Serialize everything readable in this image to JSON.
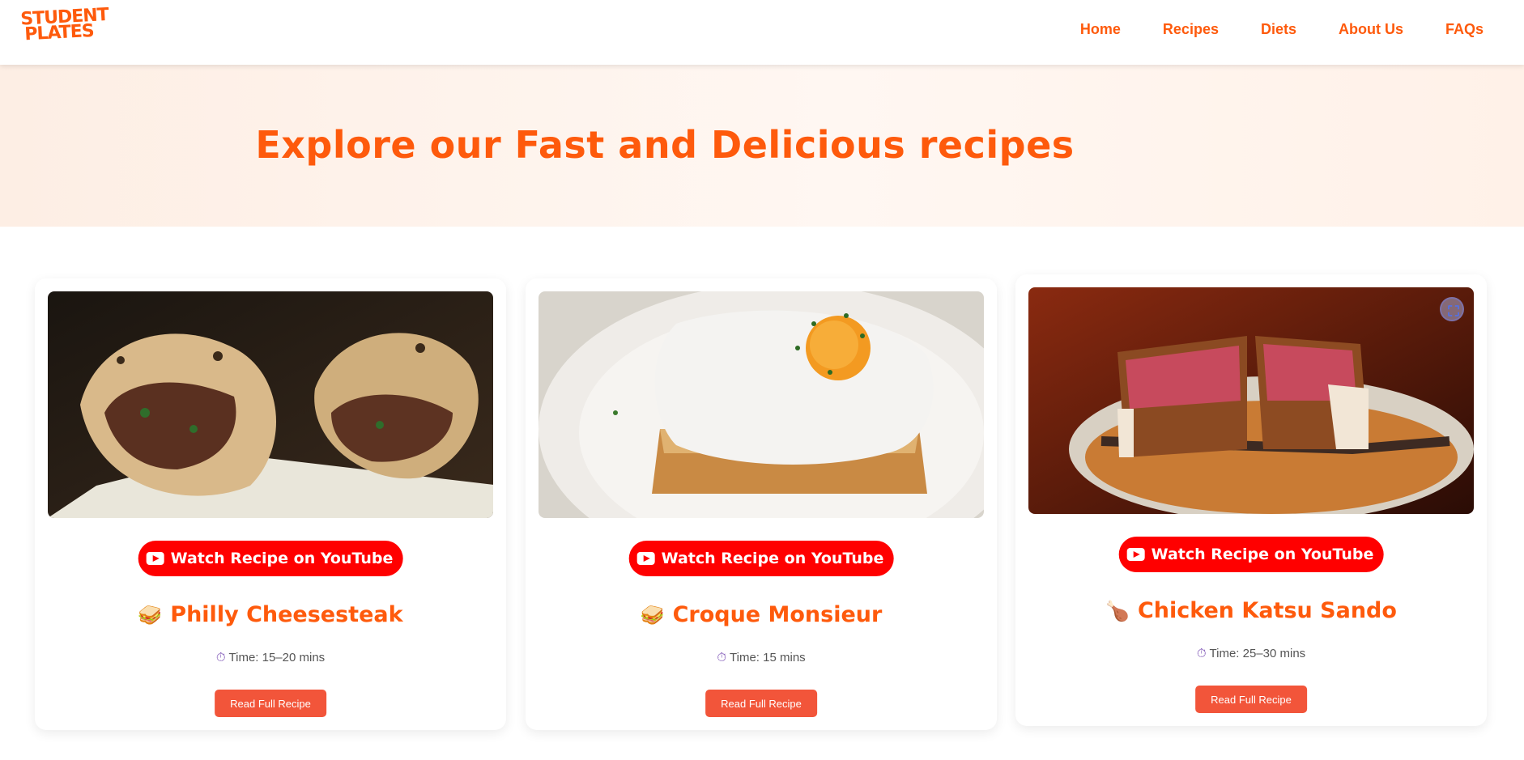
{
  "header": {
    "logo_line1": "STUDENT",
    "logo_line2": "PLATES",
    "nav": [
      "Home",
      "Recipes",
      "Diets",
      "About Us",
      "FAQs"
    ]
  },
  "hero": {
    "title": "Explore our Fast and Delicious recipes"
  },
  "recipes": [
    {
      "youtube_label": "Watch Recipe on YouTube",
      "emoji": "🥪",
      "name": "Philly Cheesesteak",
      "time": "Time: 15–20 mins",
      "read_label": "Read Full Recipe"
    },
    {
      "youtube_label": "Watch Recipe on YouTube",
      "emoji": "🥪",
      "name": "Croque Monsieur",
      "time": "Time: 15 mins",
      "read_label": "Read Full Recipe"
    },
    {
      "youtube_label": "Watch Recipe on YouTube",
      "emoji": "🍗",
      "name": "Chicken Katsu Sando",
      "time": "Time: 25–30 mins",
      "read_label": "Read Full Recipe"
    }
  ],
  "colors": {
    "brand": "#fe5a0c",
    "youtube": "#ff0000",
    "read_button": "#f2553a"
  }
}
